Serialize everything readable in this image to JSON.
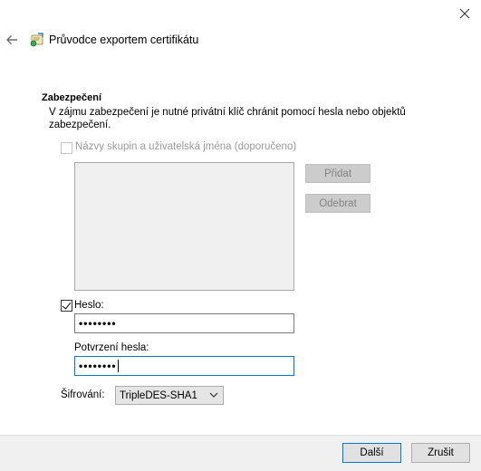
{
  "window": {
    "close_glyph": "✕"
  },
  "header": {
    "title": "Průvodce exportem certifikátu",
    "icons": {
      "back": "back-arrow-icon",
      "wizard": "certificate-wizard-icon",
      "close": "close-icon"
    }
  },
  "section": {
    "title": "Zabezpečení",
    "description": "V zájmu zabezpečení je nutné privátní klíč chránit pomocí hesla nebo objektů zabezpečení."
  },
  "groups": {
    "checkbox_label": "Názvy skupin a uživatelská jména (doporučeno)",
    "checked": false,
    "enabled": false,
    "add_label": "Přidat",
    "remove_label": "Odebrat"
  },
  "password": {
    "checkbox_label": "Heslo:",
    "checked": true,
    "value": "••••••••",
    "confirm_label": "Potvrzení hesla:",
    "confirm_value": "••••••••"
  },
  "encryption": {
    "label": "Šifrování:",
    "selected": "TripleDES-SHA1"
  },
  "footer": {
    "next_label": "Další",
    "cancel_label": "Zrušit"
  },
  "colors": {
    "accent": "#0078d7",
    "footer_bg": "#f0f0f0",
    "disabled_text": "#838383"
  }
}
